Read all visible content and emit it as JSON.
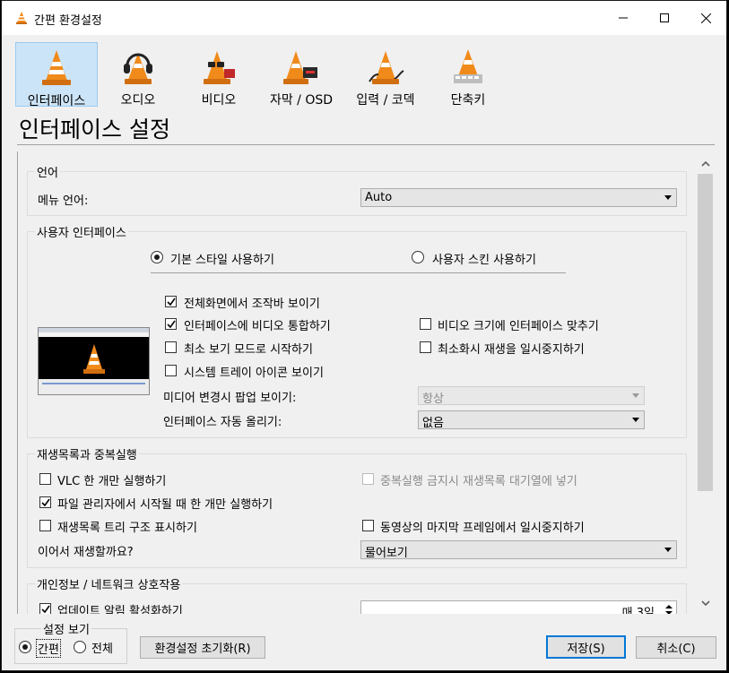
{
  "window": {
    "title": "간편 환경설정"
  },
  "categories": [
    {
      "label": "인터페이스",
      "icon": "interface-cone-icon"
    },
    {
      "label": "오디오",
      "icon": "audio-headphones-cone-icon"
    },
    {
      "label": "비디오",
      "icon": "video-glasses-cone-icon"
    },
    {
      "label": "자막 / OSD",
      "icon": "subtitles-cone-icon"
    },
    {
      "label": "입력 / 코덱",
      "icon": "input-codec-cone-icon"
    },
    {
      "label": "단축키",
      "icon": "hotkeys-cone-icon"
    }
  ],
  "page_title": "인터페이스 설정",
  "language": {
    "group_title": "언어",
    "menu_language_label": "메뉴 언어:",
    "menu_language_value": "Auto"
  },
  "ui": {
    "group_title": "사용자 인터페이스",
    "radio_native": "기본 스타일 사용하기",
    "radio_skins": "사용자 스킨 사용하기",
    "fullscreen_controls": "전체화면에서 조작바 보이기",
    "embed_video": "인터페이스에 비디오 통합하기",
    "resize_to_video": "비디오 크기에 인터페이스 맞추기",
    "minimal_view": "최소 보기 모드로 시작하기",
    "pause_minimized": "최소화시 재생을 일시중지하기",
    "systray": "시스템 트레이 아이콘 보이기",
    "popup_label": "미디어 변경시 팝업 보이기:",
    "popup_value": "항상",
    "raise_label": "인터페이스 자동 올리기:",
    "raise_value": "없음"
  },
  "playlist": {
    "group_title": "재생목록과 중복실행",
    "one_instance": "VLC 한 개만 실행하기",
    "enqueue": "중복실행 금지시 재생목록 대기열에 넣기",
    "one_instance_fm": "파일 관리자에서 시작될 때 한 개만 실행하기",
    "tree": "재생목록 트리 구조 표시하기",
    "pause_last_frame": "동영상의 마지막 프레임에서 일시중지하기",
    "resume_label": "이어서 재생할까요?",
    "resume_value": "물어보기"
  },
  "privacy": {
    "group_title": "개인정보 / 네트워크 상호작용",
    "updates": "업데이트 알림 활성화하기",
    "updates_days": "매 3일"
  },
  "footer": {
    "show_settings_title": "설정 보기",
    "simple": "간편",
    "all": "전체",
    "reset": "환경설정 초기화(R)",
    "save": "저장(S)",
    "cancel": "취소(C)"
  },
  "colors": {
    "cone_orange": "#f08a1a",
    "selected_tab": "#cce4f7",
    "default_button": "#0078d7"
  }
}
